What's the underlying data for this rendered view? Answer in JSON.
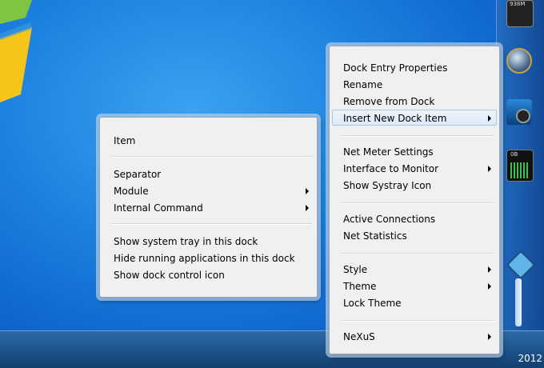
{
  "menu_main": {
    "items": [
      {
        "label": "Dock Entry Properties",
        "submenu": false
      },
      {
        "label": "Rename",
        "submenu": false
      },
      {
        "label": "Remove from Dock",
        "submenu": false
      },
      {
        "label": "Insert New Dock Item",
        "submenu": true,
        "highlighted": true
      },
      {
        "label": "Net Meter Settings",
        "submenu": false
      },
      {
        "label": "Interface to Monitor",
        "submenu": true
      },
      {
        "label": "Show Systray Icon",
        "submenu": false
      },
      {
        "label": "Active Connections",
        "submenu": false
      },
      {
        "label": "Net Statistics",
        "submenu": false
      },
      {
        "label": "Style",
        "submenu": true
      },
      {
        "label": "Theme",
        "submenu": true
      },
      {
        "label": "Lock Theme",
        "submenu": false
      },
      {
        "label": "NeXuS",
        "submenu": true
      }
    ]
  },
  "menu_sub": {
    "items": [
      {
        "label": "Item",
        "submenu": false
      },
      {
        "label": "Separator",
        "submenu": false
      },
      {
        "label": "Module",
        "submenu": true
      },
      {
        "label": "Internal Command",
        "submenu": true
      },
      {
        "label": "Show system tray in this dock",
        "submenu": false
      },
      {
        "label": "Hide running applications in this dock",
        "submenu": false
      },
      {
        "label": "Show dock control icon",
        "submenu": false
      }
    ]
  },
  "dock": {
    "icons": [
      "memory-meter-icon",
      "globe-icon",
      "camera-icon",
      "net-meter-icon",
      "settings-icon"
    ],
    "memory_label": "938M",
    "net_label": "0B"
  },
  "taskbar": {
    "clock_text": "2012"
  },
  "colors": {
    "desktop": "#1c7fde",
    "menu_bg": "#f0f0f0",
    "highlight": "#dce9f7"
  }
}
